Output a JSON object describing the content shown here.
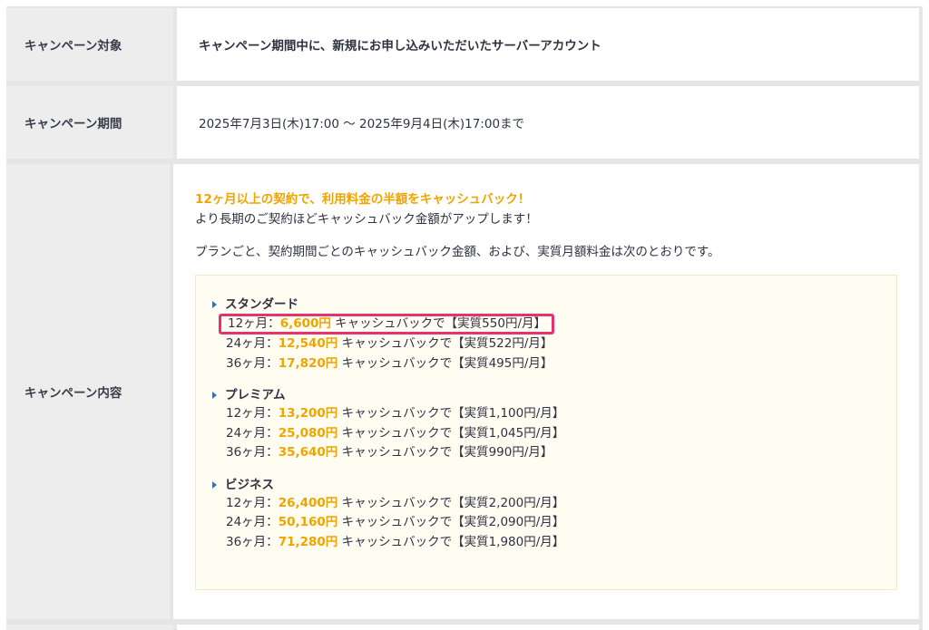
{
  "rows": [
    {
      "label": "キャンペーン対象",
      "value": "キャンペーン期間中に、新規にお申し込みいただいたサーバーアカウント"
    },
    {
      "label": "キャンペーン期間",
      "value": "2025年7月3日(木)17:00 〜 2025年9月4日(木)17:00まで"
    },
    {
      "label": "キャンペーン内容"
    }
  ],
  "content": {
    "headline": "12ヶ月以上の契約で、利用料金の半額をキャッシュバック！",
    "subline": "より長期のご契約ほどキャッシュバック金額がアップします！",
    "note": "プランごと、契約期間ごとのキャッシュバック金額、および、実質月額料金は次のとおりです。",
    "plans": [
      {
        "name": "スタンダード",
        "items": [
          {
            "term": "12ヶ月：",
            "amount": "6,600円",
            "text": " キャッシュバックで【実質550円/月】"
          },
          {
            "term": "24ヶ月：",
            "amount": "12,540円",
            "text": " キャッシュバックで【実質522円/月】"
          },
          {
            "term": "36ヶ月：",
            "amount": "17,820円",
            "text": " キャッシュバックで【実質495円/月】"
          }
        ]
      },
      {
        "name": "プレミアム",
        "items": [
          {
            "term": "12ヶ月：",
            "amount": "13,200円",
            "text": " キャッシュバックで【実質1,100円/月】"
          },
          {
            "term": "24ヶ月：",
            "amount": "25,080円",
            "text": " キャッシュバックで【実質1,045円/月】"
          },
          {
            "term": "36ヶ月：",
            "amount": "35,640円",
            "text": " キャッシュバックで【実質990円/月】"
          }
        ]
      },
      {
        "name": "ビジネス",
        "items": [
          {
            "term": "12ヶ月：",
            "amount": "26,400円",
            "text": " キャッシュバックで【実質2,200円/月】"
          },
          {
            "term": "24ヶ月：",
            "amount": "50,160円",
            "text": " キャッシュバックで【実質2,090円/月】"
          },
          {
            "term": "36ヶ月：",
            "amount": "71,280円",
            "text": " キャッシュバックで【実質1,980円/月】"
          }
        ]
      }
    ]
  },
  "colors": {
    "accent_orange": "#f0a400",
    "highlight_pink": "#e8326d",
    "bullet_blue": "#3b6fb4"
  }
}
